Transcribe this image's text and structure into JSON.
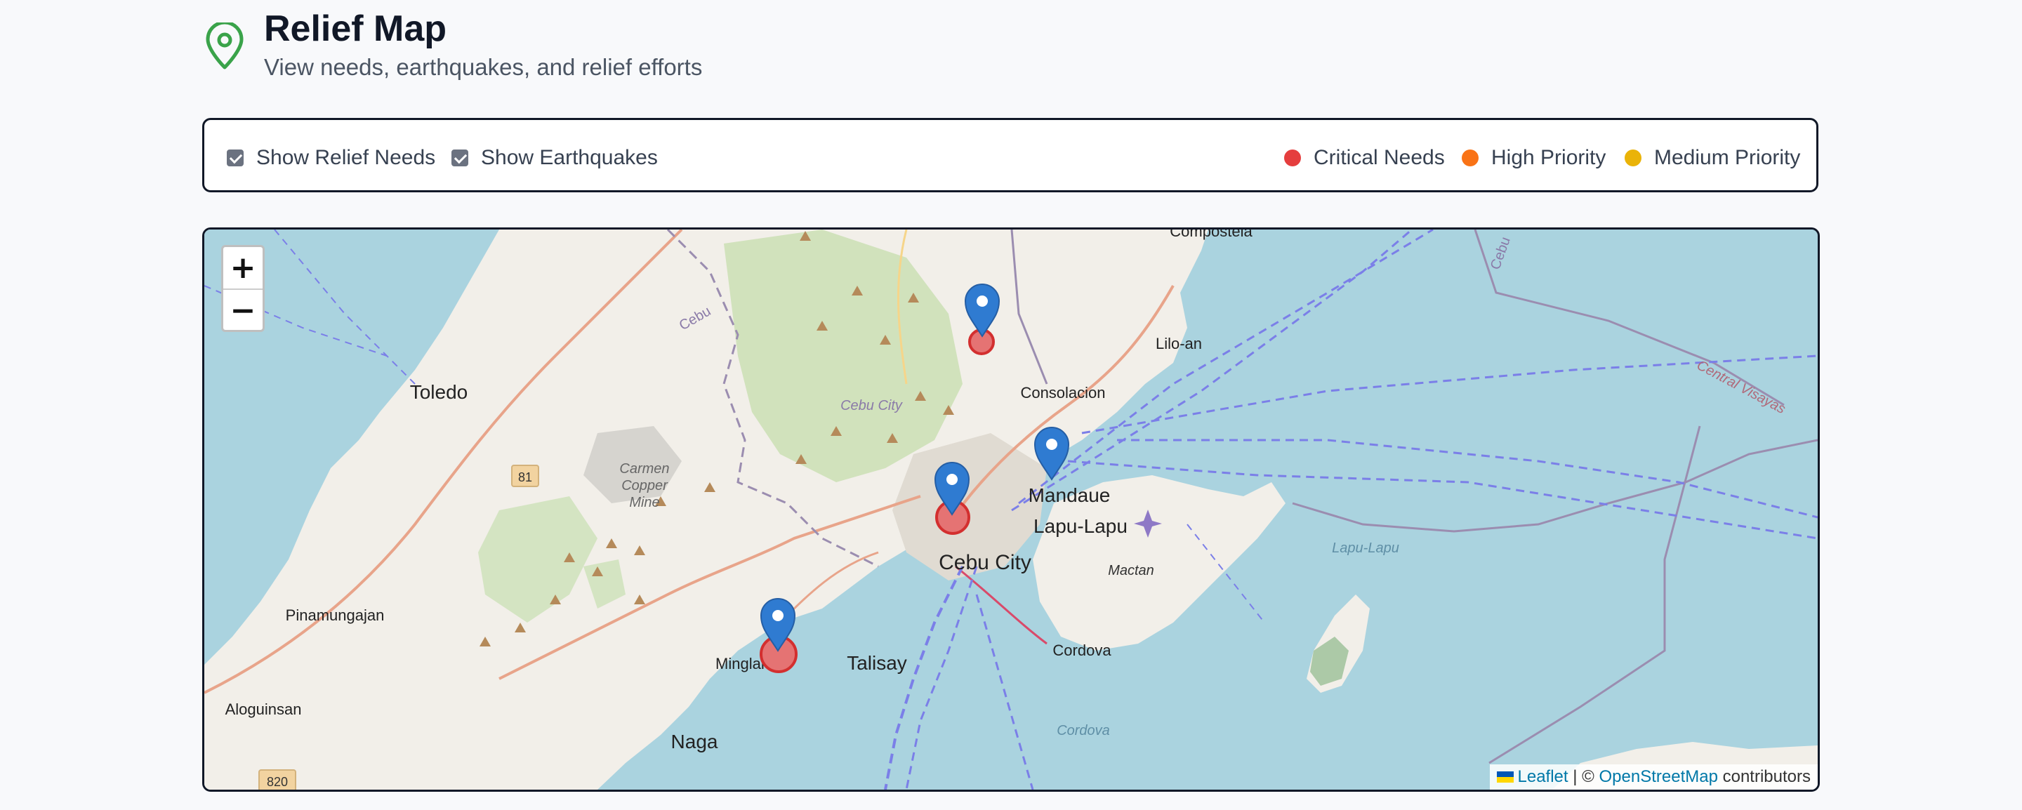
{
  "header": {
    "title": "Relief Map",
    "subtitle": "View needs, earthquakes, and relief efforts",
    "icon": "map-pin-icon",
    "icon_color": "#3aa34a"
  },
  "controls": {
    "show_relief_needs": {
      "label": "Show Relief Needs",
      "checked": true
    },
    "show_earthquakes": {
      "label": "Show Earthquakes",
      "checked": true
    },
    "legend": [
      {
        "label": "Critical Needs",
        "color": "#e53e3e"
      },
      {
        "label": "High Priority",
        "color": "#f97316"
      },
      {
        "label": "Medium Priority",
        "color": "#eab308"
      }
    ]
  },
  "map": {
    "zoom_in": "+",
    "zoom_out": "−",
    "attribution": {
      "leaflet": "Leaflet",
      "separator": " | © ",
      "osm": "OpenStreetMap",
      "suffix": " contributors"
    },
    "places": {
      "compostela": "Compostela",
      "cebu": "Cebu",
      "toledo": "Toledo",
      "liloan": "Lilo-an",
      "consolacion": "Consolacion",
      "cebu_city_area": "Cebu City",
      "carmen_copper_mine": [
        "Carmen",
        "Copper",
        "Mine"
      ],
      "route_81": "81",
      "mandaue": "Mandaue",
      "lapu_lapu": "Lapu-Lapu",
      "cebu_city": "Cebu City",
      "mactan": "Mactan",
      "lapu_lapu_water": "Lapu-Lapu",
      "pinamungajan": "Pinamungajan",
      "minglanilla": "Minglanilla",
      "talisay": "Talisay",
      "cordova": "Cordova",
      "cordova_water": "Cordova",
      "aloguinsan": "Aloguinsan",
      "naga": "Naga",
      "route_820": "820",
      "central_visayas": "Central Visayas",
      "cebu_strait": "Cebu"
    },
    "markers": [
      {
        "type": "relief-need",
        "priority": "critical"
      },
      {
        "type": "relief-need",
        "priority": "critical"
      },
      {
        "type": "relief-need",
        "priority": "critical"
      },
      {
        "type": "earthquake"
      },
      {
        "type": "earthquake"
      },
      {
        "type": "earthquake"
      },
      {
        "type": "earthquake"
      }
    ],
    "marker_colors": {
      "pin": "#2f7bd1",
      "critical": "#e53e3e"
    }
  }
}
